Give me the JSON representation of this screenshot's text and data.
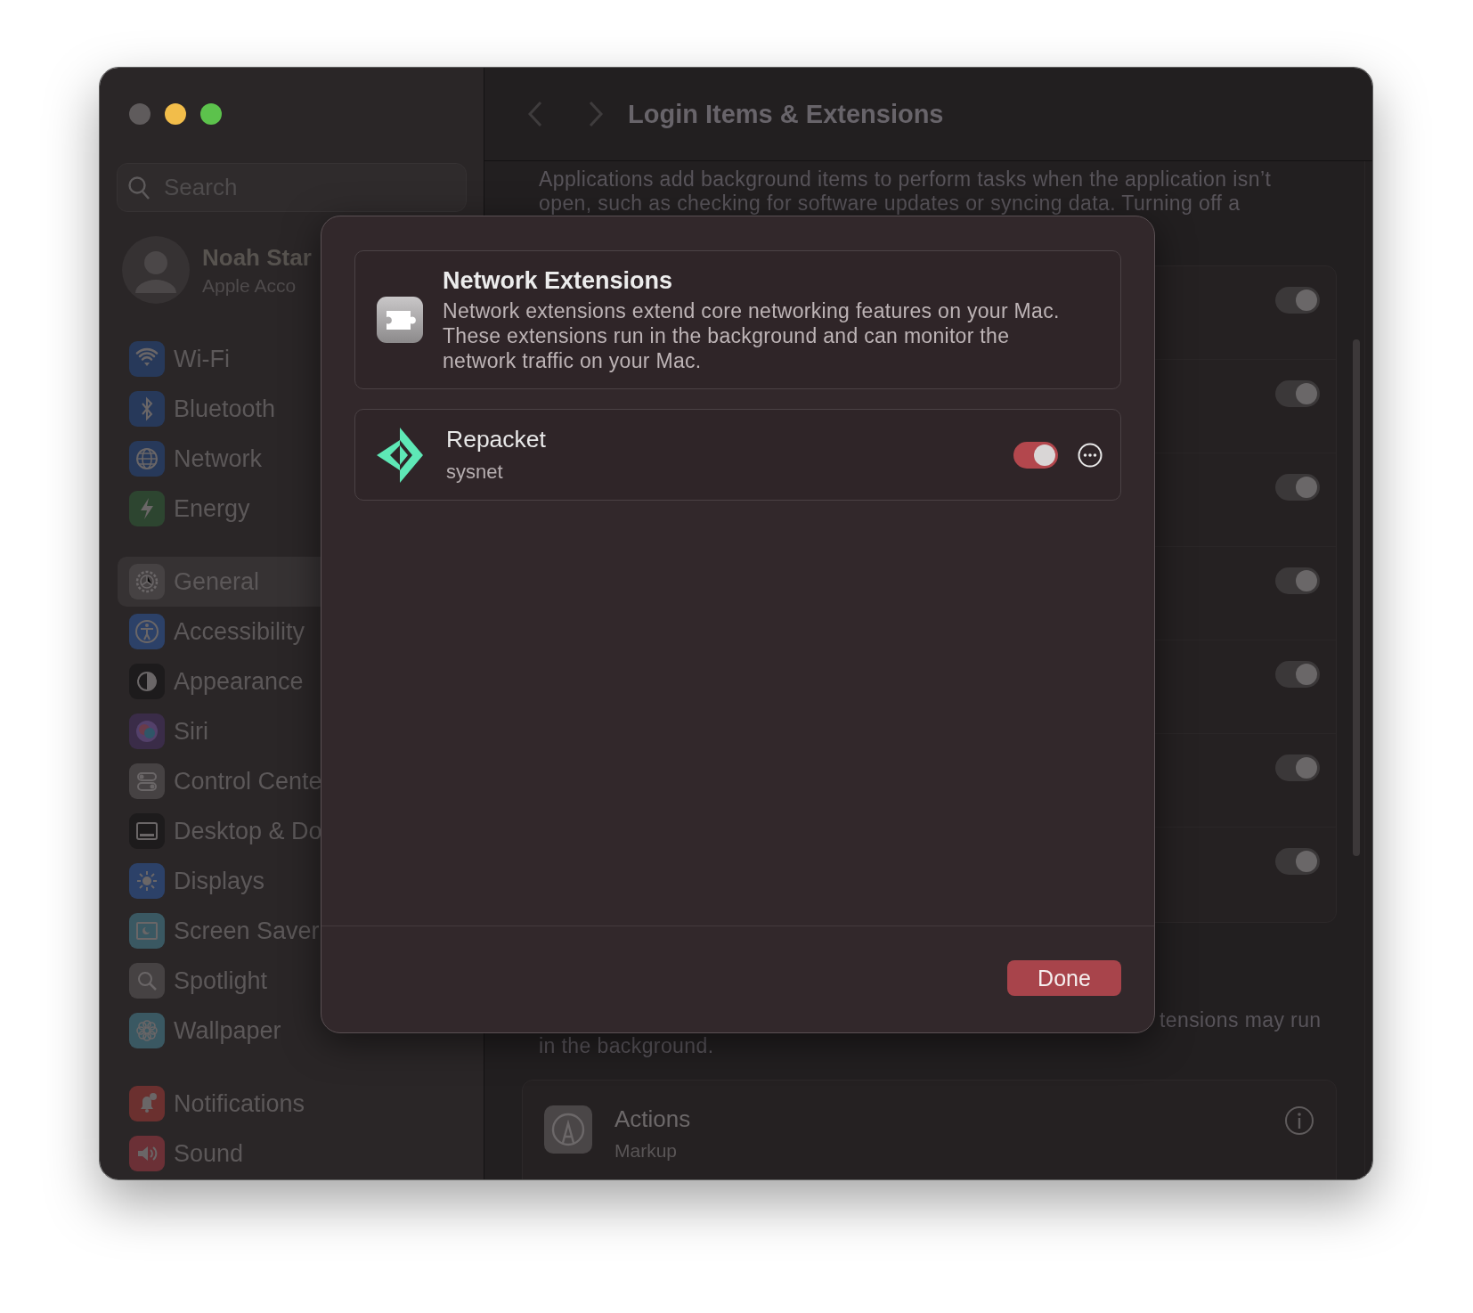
{
  "window": {
    "title": "Login Items & Extensions"
  },
  "sidebar": {
    "search": {
      "placeholder": "Search"
    },
    "account": {
      "name": "Noah Star",
      "subtitle": "Apple Acco"
    },
    "groups": [
      {
        "items": [
          {
            "label": "Wi-Fi",
            "color": "#27395a",
            "selected": false
          },
          {
            "label": "Bluetooth",
            "color": "#27395a",
            "selected": false
          },
          {
            "label": "Network",
            "color": "#27395a",
            "selected": false
          },
          {
            "label": "Energy",
            "color": "#2d4530",
            "selected": false
          }
        ]
      },
      {
        "items": [
          {
            "label": "General",
            "color": "#464243",
            "selected": true
          },
          {
            "label": "Accessibility",
            "color": "#2c4168",
            "selected": false
          },
          {
            "label": "Appearance",
            "color": "#1d1b1c",
            "selected": false
          },
          {
            "label": "Siri",
            "color": "#3a2c48",
            "selected": false
          },
          {
            "label": "Control Cente",
            "color": "#464243",
            "selected": false
          },
          {
            "label": "Desktop & Do",
            "color": "#1d1b1c",
            "selected": false
          },
          {
            "label": "Displays",
            "color": "#2c4168",
            "selected": false
          },
          {
            "label": "Screen Saver",
            "color": "#3a5862",
            "selected": false
          },
          {
            "label": "Spotlight",
            "color": "#464243",
            "selected": false
          },
          {
            "label": "Wallpaper",
            "color": "#3a5862",
            "selected": false
          }
        ]
      },
      {
        "items": [
          {
            "label": "Notifications",
            "color": "#6b302f",
            "selected": false
          },
          {
            "label": "Sound",
            "color": "#6b3036",
            "selected": false
          }
        ]
      }
    ]
  },
  "main": {
    "description": "Applications add background items to perform tasks when the application isn’t\nopen, such as checking for software updates or syncing data. Turning off a",
    "background_items": [
      {
        "on": true
      },
      {
        "on": true
      },
      {
        "on": true
      },
      {
        "on": true
      },
      {
        "on": true
      },
      {
        "on": true
      },
      {
        "on": true
      }
    ],
    "extensions_note": [
      "tensions may run",
      "in the background."
    ],
    "extensions": [
      {
        "name": "Actions",
        "subtitle": "Markup"
      }
    ]
  },
  "sheet": {
    "title": "Network Extensions",
    "description": "Network extensions extend core networking features on your Mac.\nThese extensions run in the background and can monitor the\nnetwork traffic on your Mac.",
    "items": [
      {
        "name": "Repacket",
        "subtitle": "sysnet",
        "on": true
      }
    ],
    "done_button": "Done"
  }
}
